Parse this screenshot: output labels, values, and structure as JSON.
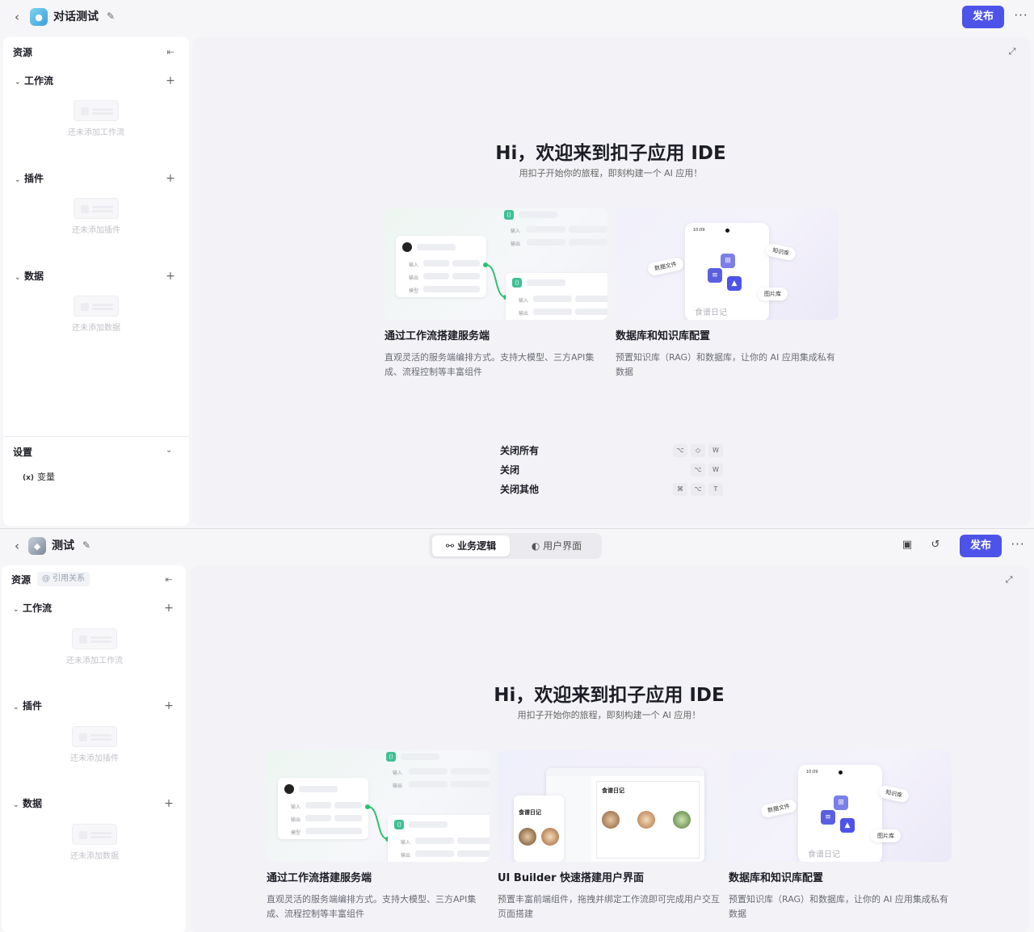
{
  "top_panel": {
    "header": {
      "app_title": "对话测试",
      "publish_label": "发布"
    },
    "sidebar": {
      "title": "资源",
      "sections": [
        {
          "label": "工作流",
          "empty_text": "还未添加工作流"
        },
        {
          "label": "插件",
          "empty_text": "还未添加插件"
        },
        {
          "label": "数据",
          "empty_text": "还未添加数据"
        }
      ],
      "settings": {
        "label": "设置",
        "variable_icon": "(x)",
        "variable_label": "变量"
      }
    },
    "main": {
      "hero_title": "Hi，欢迎来到扣子应用 IDE",
      "hero_subtitle": "用扣子开始你的旅程，即刻构建一个 AI 应用！",
      "cards": [
        {
          "title": "通过工作流搭建服务端",
          "desc": "直观灵活的服务端编排方式。支持大模型、三方API集成、流程控制等丰富组件"
        },
        {
          "title": "数据库和知识库配置",
          "desc": "预置知识库（RAG）和数据库，让你的 AI 应用集成私有数据"
        }
      ],
      "shortcuts": [
        {
          "label": "关闭所有",
          "keys": [
            "⌥",
            "◇",
            "W"
          ]
        },
        {
          "label": "关闭",
          "keys": [
            "⌥",
            "W"
          ]
        },
        {
          "label": "关闭其他",
          "keys": [
            "⌘",
            "⌥",
            "T"
          ]
        }
      ]
    }
  },
  "bottom_panel": {
    "header": {
      "app_title": "测试",
      "publish_label": "发布",
      "mode_tabs": [
        {
          "icon": "⚯",
          "label": "业务逻辑"
        },
        {
          "icon": "◐",
          "label": "用户界面"
        }
      ]
    },
    "sidebar": {
      "title": "资源",
      "ref_chip": "@ 引用关系",
      "sections": [
        {
          "label": "工作流",
          "empty_text": "还未添加工作流"
        },
        {
          "label": "插件",
          "empty_text": "还未添加插件"
        },
        {
          "label": "数据",
          "empty_text": "还未添加数据"
        }
      ]
    },
    "main": {
      "hero_title": "Hi，欢迎来到扣子应用 IDE",
      "hero_subtitle": "用扣子开始你的旅程，即刻构建一个 AI 应用！",
      "cards": [
        {
          "title": "通过工作流搭建服务端",
          "desc": "直观灵活的服务端编排方式。支持大模型、三方API集成、流程控制等丰富组件"
        },
        {
          "title": "UI Builder 快速搭建用户界面",
          "desc": "预置丰富前端组件，拖拽并绑定工作流即可完成用户交互页面搭建"
        },
        {
          "title": "数据库和知识库配置",
          "desc": "预置知识库（RAG）和数据库，让你的 AI 应用集成私有数据"
        }
      ]
    }
  },
  "illustrations": {
    "workflow_labels": {
      "input": "输入",
      "output": "输出",
      "model": "模型"
    },
    "data_labels": {
      "phone_time": "10:09",
      "app_name": "食谱日记",
      "data_file": "数据文件",
      "knowledge": "知识库",
      "images": "图片库"
    },
    "ui_builder_labels": {
      "screen_title": "食谱日记"
    }
  },
  "colors": {
    "accent": "#4d53e8",
    "workflow_green": "#3fbf94"
  },
  "icons": {
    "back": "‹",
    "edit": "✎",
    "more": "···",
    "collapse": "⇤",
    "add": "+",
    "expand": "⤢",
    "chevron_down": "⌄",
    "archive": "▣",
    "history": "↺"
  }
}
